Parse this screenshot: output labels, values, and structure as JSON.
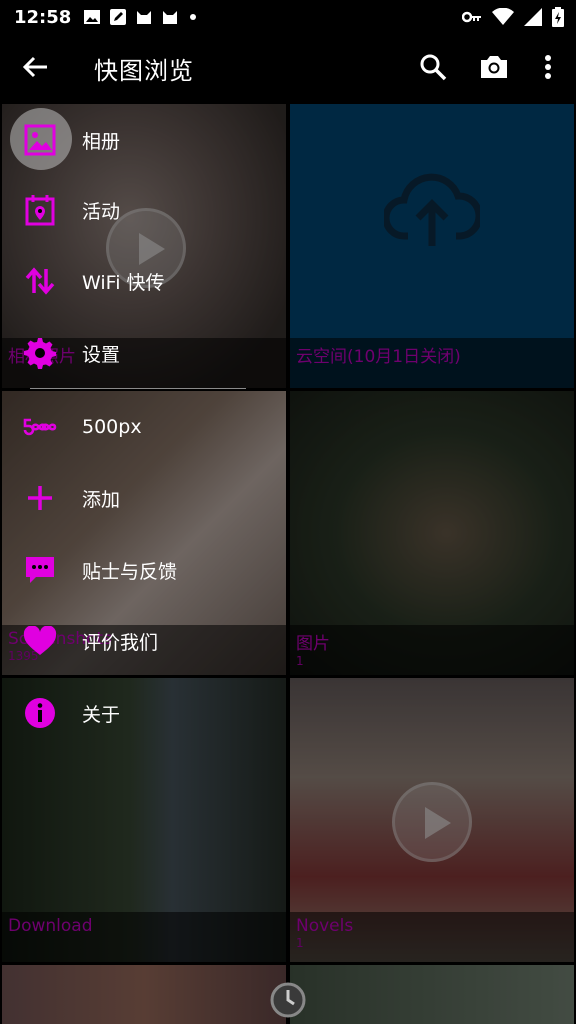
{
  "status_bar": {
    "time": "12:58"
  },
  "app_bar": {
    "title": "快图浏览"
  },
  "albums": [
    {
      "name": "相机照片",
      "count": ""
    },
    {
      "name": "云空间(10月1日关闭)",
      "count": ""
    },
    {
      "name": "Screenshots",
      "count": "1395"
    },
    {
      "name": "图片",
      "count": "1"
    },
    {
      "name": "Download",
      "count": ""
    },
    {
      "name": "Novels",
      "count": "1"
    }
  ],
  "menu": {
    "items": [
      {
        "label": "相册",
        "icon": "album-icon"
      },
      {
        "label": "活动",
        "icon": "event-icon"
      },
      {
        "label": "WiFi 快传",
        "icon": "transfer-icon"
      },
      {
        "label": "设置",
        "icon": "gear-icon"
      },
      {
        "label": "500px",
        "icon": "500px-icon"
      },
      {
        "label": "添加",
        "icon": "plus-icon"
      },
      {
        "label": "贴士与反馈",
        "icon": "feedback-icon"
      },
      {
        "label": "评价我们",
        "icon": "heart-icon"
      },
      {
        "label": "关于",
        "icon": "info-icon"
      }
    ]
  },
  "colors": {
    "accent": "#e000e0",
    "background": "#000000"
  }
}
